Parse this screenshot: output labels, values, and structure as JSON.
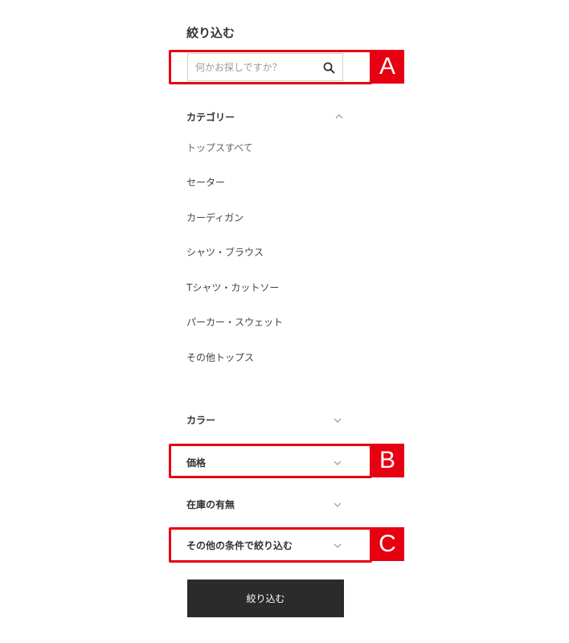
{
  "panel": {
    "title": "絞り込む"
  },
  "search": {
    "placeholder": "何かお探しですか？",
    "value": ""
  },
  "category": {
    "label": "カテゴリー",
    "items": [
      {
        "label": "トップスすべて"
      },
      {
        "label": "セーター"
      },
      {
        "label": "カーディガン"
      },
      {
        "label": "シャツ・ブラウス"
      },
      {
        "label": "Tシャツ・カットソー"
      },
      {
        "label": "パーカー・スウェット"
      },
      {
        "label": "その他トップス"
      }
    ]
  },
  "filters": {
    "color": "カラー",
    "price": "価格",
    "stock": "在庫の有無",
    "other": "その他の条件で絞り込む"
  },
  "submit_label": "絞り込む",
  "annotations": {
    "a": "A",
    "b": "B",
    "c": "C"
  },
  "colors": {
    "annotation": "#e60012",
    "button": "#2b2b2b"
  }
}
